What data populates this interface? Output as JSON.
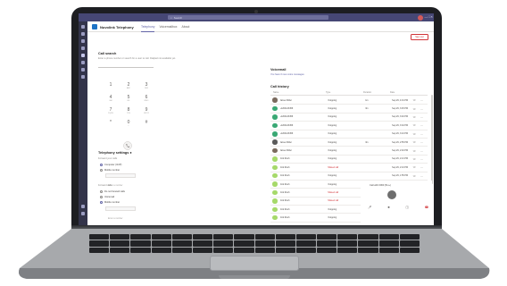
{
  "window": {
    "search_placeholder": "Search",
    "search_icon": "search-icon",
    "controls": [
      "—",
      "□",
      "✕"
    ]
  },
  "app": {
    "title": "Nuvolink Telephony",
    "tabs": [
      {
        "label": "Telephony",
        "active": true
      },
      {
        "label": "Voicemailbox",
        "active": false
      },
      {
        "label": "About",
        "active": false
      }
    ]
  },
  "call_section": {
    "title": "Call search",
    "subtitle": "Enter a phone number or search for a user to call. Dialpad not available yet.",
    "keypad": [
      {
        "digit": "1",
        "letters": ""
      },
      {
        "digit": "2",
        "letters": "ABC"
      },
      {
        "digit": "3",
        "letters": "DEF"
      },
      {
        "digit": "4",
        "letters": "GHI"
      },
      {
        "digit": "5",
        "letters": "JKL"
      },
      {
        "digit": "6",
        "letters": "MNO"
      },
      {
        "digit": "7",
        "letters": "PQRS"
      },
      {
        "digit": "8",
        "letters": "TUV"
      },
      {
        "digit": "9",
        "letters": "WXYZ"
      },
      {
        "digit": "*",
        "letters": ""
      },
      {
        "digit": "0",
        "letters": "+"
      },
      {
        "digit": "#",
        "letters": ""
      }
    ]
  },
  "telephony_settings": {
    "title": "Telephony settings",
    "sub1": "Forward your calls",
    "options1": [
      "Computer (VoIP)",
      "Mobile number",
      "Enter a number"
    ],
    "sub2": "Forward calls",
    "options2": [
      "Do not forward calls",
      "Voicemail",
      "Mobile number",
      "Enter a number"
    ]
  },
  "voicemail": {
    "title": "Voicemail",
    "link": "You have 0 new voice messages"
  },
  "top_button": "Sign out",
  "call_history": {
    "title": "Call history",
    "columns": [
      "Name",
      "Type",
      "Duration",
      "Date"
    ],
    "rows": [
      {
        "name": "James Miller",
        "type": "Outgoing",
        "dur": "1m",
        "date": "Sep 29, 4:01 PM",
        "color": "#7a6a5e"
      },
      {
        "name": "+1204123456",
        "type": "Outgoing",
        "dur": "3m",
        "date": "Sep 29, 3:45 PM",
        "color": "#3aa874"
      },
      {
        "name": "+1204123456",
        "type": "Outgoing",
        "dur": "",
        "date": "Sep 29, 3:40 PM",
        "color": "#3aa874"
      },
      {
        "name": "+1204123456",
        "type": "Outgoing",
        "dur": "",
        "date": "Sep 29, 3:32 PM",
        "color": "#3aa874"
      },
      {
        "name": "+1204123456",
        "type": "Outgoing",
        "dur": "",
        "date": "Sep 29, 3:10 PM",
        "color": "#3aa874"
      },
      {
        "name": "James Miller",
        "type": "Outgoing",
        "dur": "3m",
        "date": "Sep 29, 2:55 PM",
        "color": "#5a5a5a"
      },
      {
        "name": "James Miller",
        "type": "Outgoing",
        "dur": "",
        "date": "Sep 29, 2:40 PM",
        "color": "#7a6a5e"
      },
      {
        "name": "Nick Rush",
        "type": "Outgoing",
        "dur": "",
        "date": "Sep 29, 2:21 PM",
        "color": "#a6d96a"
      },
      {
        "name": "Nick Rush",
        "type": "Missed call",
        "dur": "",
        "date": "Sep 29, 2:10 PM",
        "color": "#a6d96a",
        "missed": true
      },
      {
        "name": "Nick Rush",
        "type": "Outgoing",
        "dur": "",
        "date": "Sep 29, 1:55 PM",
        "color": "#a6d96a"
      },
      {
        "name": "Nick Rush",
        "type": "Outgoing",
        "dur": "",
        "date": "Sep 29, 1:40 PM",
        "color": "#a6d96a"
      },
      {
        "name": "Nick Rush",
        "type": "Missed call",
        "dur": "",
        "date": "Sep 29, 1:30 PM",
        "color": "#a6d96a",
        "missed": true
      },
      {
        "name": "Nick Rush",
        "type": "Missed call",
        "dur": "",
        "date": "Sep 29, 1:21 PM",
        "color": "#a6d96a",
        "missed": true
      },
      {
        "name": "Nick Rush",
        "type": "Outgoing",
        "dur": "",
        "date": "Sep 29, 1:10 PM",
        "color": "#a6d96a"
      },
      {
        "name": "Nick Rush",
        "type": "Outgoing",
        "dur": "",
        "date": "Sep 29, 1:00 PM",
        "color": "#a6d96a"
      }
    ]
  },
  "active_call": {
    "status": "Call with 0060 (5m+)",
    "controls": [
      "mic-icon",
      "video-icon",
      "pause-icon",
      "hangup-icon"
    ]
  },
  "colors": {
    "teams_header": "#464775",
    "accent": "#6264a7",
    "missed": "#d13438"
  }
}
